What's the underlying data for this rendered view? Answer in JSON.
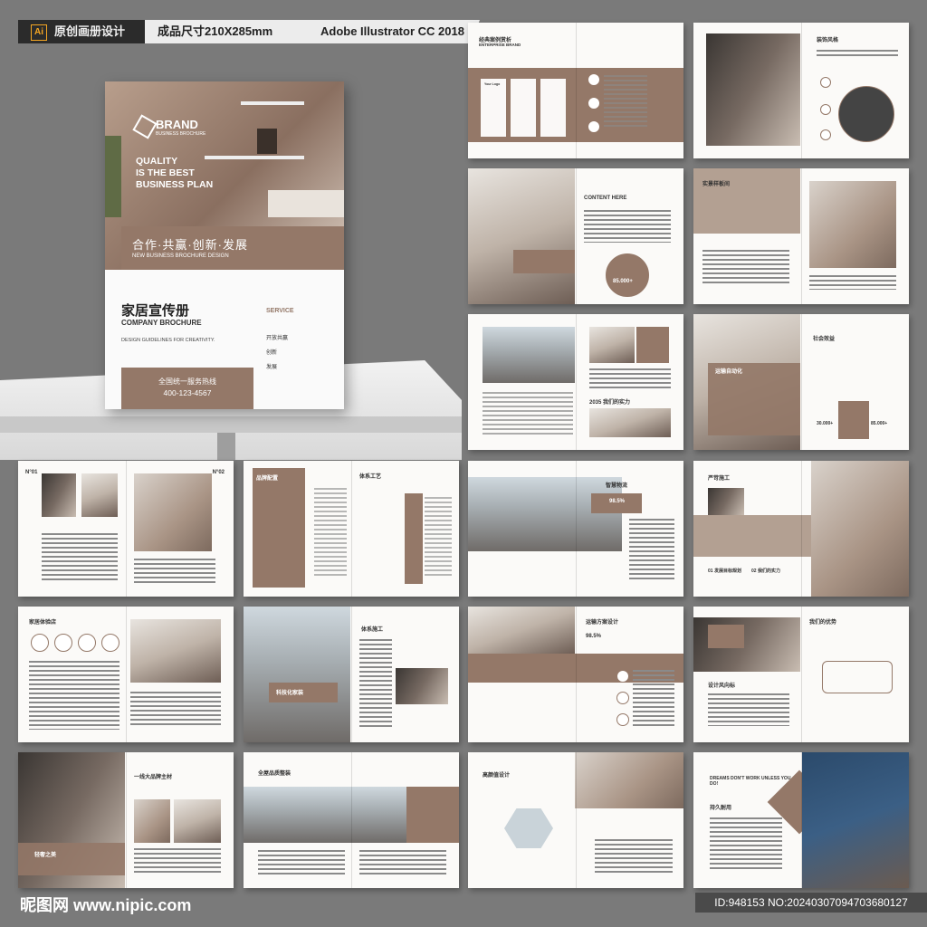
{
  "topbar": {
    "ai_badge": "Ai",
    "tag1": "原创画册设计",
    "tag2": "成品尺寸210X285mm",
    "tag3": "Adobe Illustrator CC 2018"
  },
  "cover": {
    "brand": "BRAND",
    "brand_sub": "BUSINESS BROCHURE",
    "headline_1": "QUALITY",
    "headline_2": "IS THE BEST",
    "headline_3": "BUSINESS PLAN",
    "band_cn": "合作·共赢·创新·发展",
    "band_en": "NEW BUSINESS BROCHURE DESIGN",
    "title_cn": "家居宣传册",
    "title_en": "COMPANY BROCHURE",
    "tagline": "DESIGN GUIDELINES FOR CREATIVITY.",
    "service_label": "SERVICE",
    "service_items": [
      "开放共赢",
      "创新",
      "发展"
    ],
    "hotline_label": "全国统一服务热线",
    "hotline": "400-123-4567"
  },
  "spreads": {
    "s1_title": "经典案例赏析",
    "s1_sub": "ENTERPRISE BRAND",
    "s1_logo": "Your Logo",
    "s2_title": "装饰风格",
    "s3_title": "CONTENT HERE",
    "s3_value": "85.000+",
    "s4_title": "实景样板间",
    "s5_title": "2035 我们的实力",
    "s6_title": "运输自动化",
    "s6_title2": "社会效益",
    "s6_value1": "30.000+",
    "s6_value2": "85.000+",
    "s7_label1": "N°01",
    "s7_label2": "N°02",
    "s8_title": "品牌配置",
    "s8_title2": "体系工艺",
    "s9_title": "智慧物流",
    "s9_value": "98.5%",
    "s10_title": "严苛施工",
    "s10_items": [
      "01 发展目标规划",
      "02 我们的实力"
    ],
    "s11_title": "家居体验店",
    "s12_title": "体系施工",
    "s12_caption": "科技化家装",
    "s13_title": "运输方案设计",
    "s13_value": "98.5%",
    "s14_title": "我们的优势",
    "s14_sub": "设计风向标",
    "s15_title": "一线大品牌主材",
    "s15_caption": "轻奢之美",
    "s16_title": "全屋品质整装",
    "s17_title": "高颜值设计",
    "s18_title": "DREAMS DON'T WORK UNLESS YOU DO!",
    "s18_sub": "持久耐用"
  },
  "footer": {
    "logo": "昵图网 www.nipic.com",
    "id": "ID:948153 NO:20240307094703680127"
  },
  "colors": {
    "accent": "#947868",
    "background": "#7a7a7a"
  }
}
